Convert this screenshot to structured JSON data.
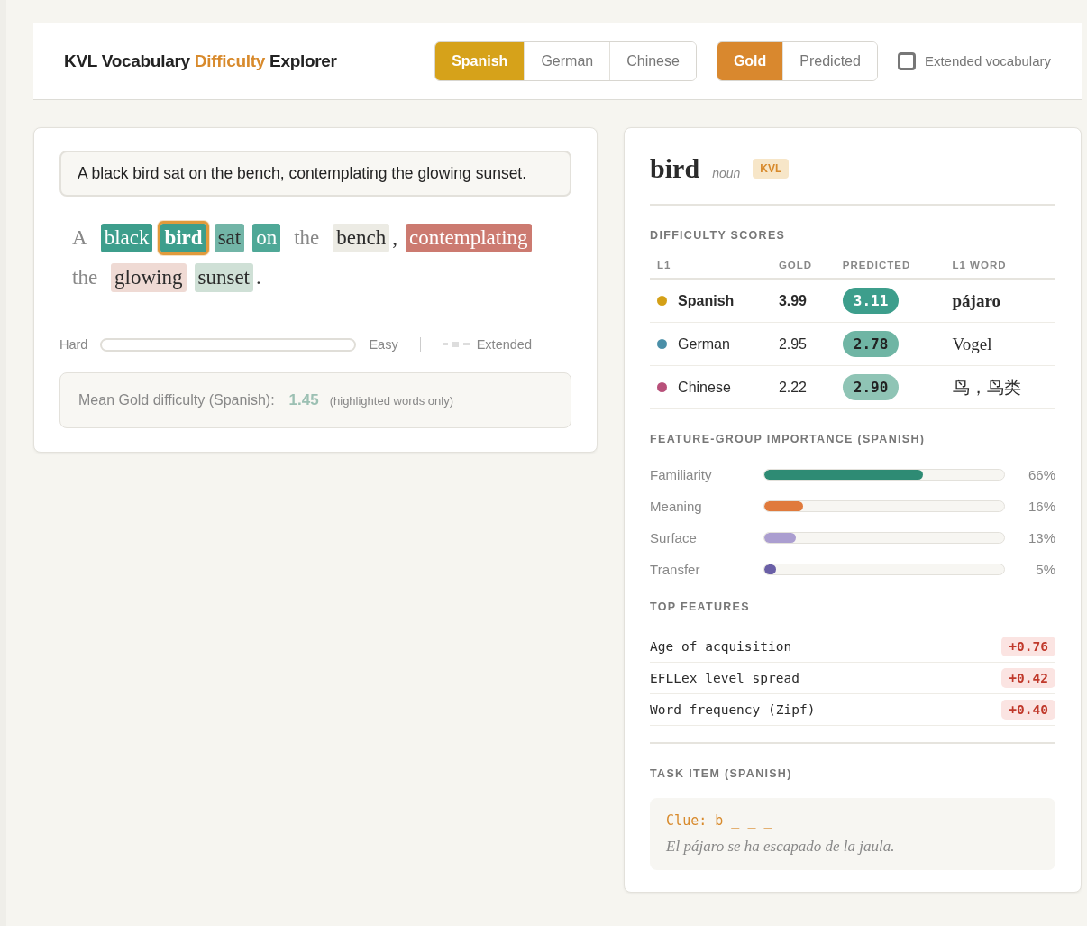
{
  "header": {
    "title": [
      {
        "text": "KVL Vocabulary",
        "accent": false
      },
      {
        "text": "Difficulty",
        "accent": true
      },
      {
        "text": "Explorer",
        "accent": false
      }
    ],
    "languages": [
      {
        "label": "Spanish",
        "selected": true
      },
      {
        "label": "German",
        "selected": false
      },
      {
        "label": "Chinese",
        "selected": false
      }
    ],
    "modes": [
      {
        "label": "Gold",
        "selected": true
      },
      {
        "label": "Predicted",
        "selected": false
      }
    ],
    "extended": {
      "label": "Extended vocabulary",
      "checked": false
    }
  },
  "sentence_card": {
    "sentence": "A black bird sat on the bench, contemplating the glowing sunset.",
    "tokens": [
      {
        "text": "A",
        "kind": "plain"
      },
      {
        "text": "black",
        "kind": "word",
        "color": "#3d9e8c",
        "selected": false
      },
      {
        "text": "bird",
        "kind": "word",
        "color": "#3d9e8c",
        "selected": true
      },
      {
        "text": "sat",
        "kind": "word",
        "color": "#72b5a7",
        "selected": false
      },
      {
        "text": "on",
        "kind": "word",
        "color": "#4fa897",
        "selected": false
      },
      {
        "text": "the",
        "kind": "plain"
      },
      {
        "text": "bench",
        "kind": "word",
        "color": "#ecebe4",
        "selected": false
      },
      {
        "text": ",",
        "kind": "punct"
      },
      {
        "text": "contemplating",
        "kind": "word",
        "color": "#cc7a70",
        "selected": false
      },
      {
        "text": "the",
        "kind": "plain"
      },
      {
        "text": "glowing",
        "kind": "word",
        "color": "#efdad4",
        "selected": false
      },
      {
        "text": "sunset",
        "kind": "word",
        "color": "#cfe0d6",
        "selected": false
      },
      {
        "text": ".",
        "kind": "punct"
      }
    ],
    "legend": {
      "hard": "Hard",
      "easy": "Easy",
      "extended": "Extended"
    },
    "mean": {
      "label": "Mean Gold difficulty (Spanish):",
      "value": "1.45",
      "note": "(highlighted words only)"
    }
  },
  "detail": {
    "word": "bird",
    "pos": "noun",
    "badge": "KVL",
    "scores_title": "DIFFICULTY SCORES",
    "columns": [
      "L1",
      "GOLD",
      "PREDICTED",
      "L1 WORD"
    ],
    "rows": [
      {
        "l1": "Spanish",
        "color": "#d4a017",
        "gold": "3.99",
        "predicted": {
          "text": "3.11",
          "color": "#3d9e8c"
        },
        "word": "pájaro",
        "selected": true
      },
      {
        "l1": "German",
        "color": "#4a8fa8",
        "gold": "2.95",
        "predicted": {
          "text": "2.78",
          "color": "#6fb5a4"
        },
        "word": "Vogel",
        "selected": false
      },
      {
        "l1": "Chinese",
        "color": "#b8507a",
        "gold": "2.22",
        "predicted": {
          "text": "2.90",
          "color": "#8fc4b5"
        },
        "word": "鸟，鸟类",
        "selected": false
      }
    ],
    "importance_title": "FEATURE-GROUP IMPORTANCE (SPANISH)",
    "groups": [
      {
        "name": "Familiarity",
        "level": 0.66,
        "reading": "66%",
        "color": "#2e8b74"
      },
      {
        "name": "Meaning",
        "level": 0.16,
        "reading": "16%",
        "color": "#e07a3c"
      },
      {
        "name": "Surface",
        "level": 0.13,
        "reading": "13%",
        "color": "#ab9ed0"
      },
      {
        "name": "Transfer",
        "level": 0.05,
        "reading": "5%",
        "color": "#6a5fa6"
      }
    ],
    "top_title": "TOP FEATURES",
    "features": [
      {
        "name": "Age of acquisition",
        "value": "+0.76"
      },
      {
        "name": "EFLLex level spread",
        "value": "+0.42"
      },
      {
        "name": "Word frequency (Zipf)",
        "value": "+0.40"
      }
    ],
    "task_title": "TASK ITEM (SPANISH)",
    "clue": "Clue: b _ _ _",
    "example": "El pájaro se ha escapado de la jaula."
  }
}
